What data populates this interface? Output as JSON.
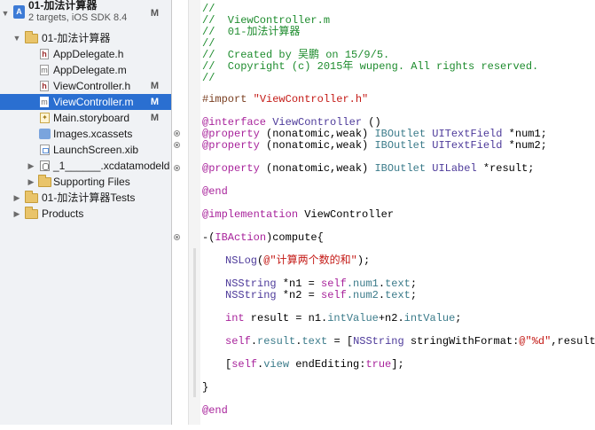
{
  "navigator": {
    "project": {
      "name": "01-加法计算器",
      "subtitle": "2 targets, iOS SDK 8.4",
      "badge": "M"
    },
    "items": [
      {
        "label": "01-加法计算器",
        "badge": ""
      },
      {
        "label": "AppDelegate.h",
        "badge": ""
      },
      {
        "label": "AppDelegate.m",
        "badge": ""
      },
      {
        "label": "ViewController.h",
        "badge": "M"
      },
      {
        "label": "ViewController.m",
        "badge": "M"
      },
      {
        "label": "Main.storyboard",
        "badge": "M"
      },
      {
        "label": "Images.xcassets",
        "badge": ""
      },
      {
        "label": "LaunchScreen.xib",
        "badge": ""
      },
      {
        "label": "_1______.xcdatamodeld",
        "badge": ""
      },
      {
        "label": "Supporting Files",
        "badge": ""
      },
      {
        "label": "01-加法计算器Tests",
        "badge": ""
      },
      {
        "label": "Products",
        "badge": ""
      }
    ]
  },
  "editor": {
    "header": [
      "//",
      "//  ViewController.m",
      "//  01-加法计算器",
      "//",
      "//  Created by 吴鹏 on 15/9/5.",
      "//  Copyright (c) 2015年 wupeng. All rights reserved.",
      "//"
    ],
    "import": {
      "kw": "#import",
      "str": "\"ViewController.h\""
    },
    "interface": {
      "kw": "@interface",
      "cls": "ViewController",
      "rest": " ()"
    },
    "properties": [
      {
        "kw": "@property",
        "attrs": "(nonatomic,weak)",
        "outlet": "IBOutlet",
        "type": "UITextField",
        "name": "*num1;"
      },
      {
        "kw": "@property",
        "attrs": "(nonatomic,weak)",
        "outlet": "IBOutlet",
        "type": "UITextField",
        "name": "*num2;"
      },
      {
        "kw": "@property",
        "attrs": "(nonatomic,weak)",
        "outlet": "IBOutlet",
        "type": "UILabel",
        "name": "*result;"
      }
    ],
    "end1": "@end",
    "implementation": {
      "kw": "@implementation",
      "name": "ViewController"
    },
    "method": {
      "pre": "-(",
      "kw": "IBAction",
      "rest": ")compute{"
    },
    "nslog": {
      "fn": "NSLog",
      "open": "(",
      "str": "@\"计算两个数的和\"",
      "close": ");"
    },
    "n1": {
      "cls": "NSString",
      "mid": " *n1 = ",
      "self": "self",
      "prop": ".num1",
      "dot": ".",
      "text": "text",
      "end": ";"
    },
    "n2": {
      "cls": "NSString",
      "mid": " *n2 = ",
      "self": "self",
      "prop": ".num2",
      "dot": ".",
      "text": "text",
      "end": ";"
    },
    "intline": {
      "kw": "int",
      "a": " result = n1.",
      "m1": "intValue",
      "b": "+n2.",
      "m2": "intValue",
      "end": ";"
    },
    "setline": {
      "self": "self",
      "dot1": ".",
      "result": "result",
      "dot2": ".",
      "text": "text",
      "eq": " = [",
      "cls": "NSString",
      "sp": " ",
      "fn": "stringWithFormat:",
      "str": "@\"%d\"",
      "end": ",result];"
    },
    "endedit": {
      "open": "[",
      "self": "self",
      "dot": ".",
      "view": "view",
      "sp": " endEditing:",
      "kw": "true",
      "end": "];"
    },
    "closebrace": "}",
    "end2": "@end"
  }
}
